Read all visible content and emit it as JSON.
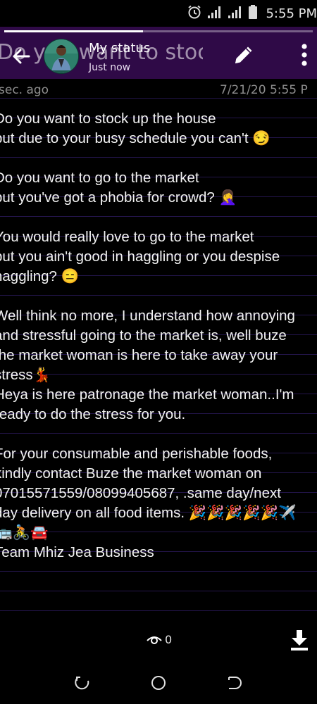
{
  "status_bar": {
    "time": "5:55 PM",
    "icons": [
      "alarm-icon",
      "signal-icon",
      "signal-icon",
      "battery-icon"
    ]
  },
  "header": {
    "title": "My status",
    "subtitle": "Just now",
    "background_title": "Do you want to stock up",
    "progress": 0.45,
    "accent_color": "#2f0a47",
    "icons": [
      "back-arrow-icon",
      "edit-pencil-icon",
      "more-vert-icon"
    ]
  },
  "note": {
    "age": "sec. ago",
    "date": "7/21/20 5:55 P",
    "lines": [
      "Do you want to stock up the house",
      "but due to your busy schedule you can't 😏",
      "",
      "Do you want to go to the market",
      "but you've got a phobia for crowd? 🤦‍♀️",
      "",
      "You would really love to go to the market",
      "but you ain't good in haggling or you despise",
      "haggling? 😑",
      "",
      "Well think no more, I understand how annoying",
      "and stressful going to the market is, well buze",
      "the market woman is here to take away  your",
      "stress💃",
      "Heya is here patronage the market woman..I'm",
      "ready to do the stress for you.",
      "",
      "For your consumable and perishable foods,",
      "kindly contact Buze the market woman on",
      "07015571559/08099405687, .same day/next",
      "day delivery on all food items. 🎉🎉🎉🎉🎉✈️",
      "🚌🚴🚘",
      "Team Mhiz Jea Business"
    ]
  },
  "footer": {
    "view_count": "0",
    "icons": [
      "eye-icon",
      "download-icon"
    ]
  },
  "navigation": {
    "icons": [
      "recent-apps-icon",
      "home-icon",
      "back-icon"
    ]
  }
}
